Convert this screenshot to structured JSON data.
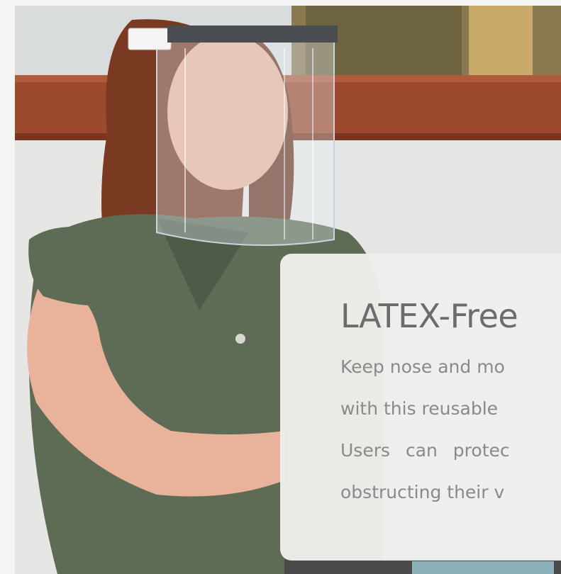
{
  "hero": {
    "image_description_icon": "woman-wearing-face-shield-photo"
  },
  "card": {
    "title": "LATEX-Free",
    "body_lines": [
      "Keep nose and mo",
      "with this reusable",
      "Users can protec",
      "obstructing their v"
    ]
  }
}
